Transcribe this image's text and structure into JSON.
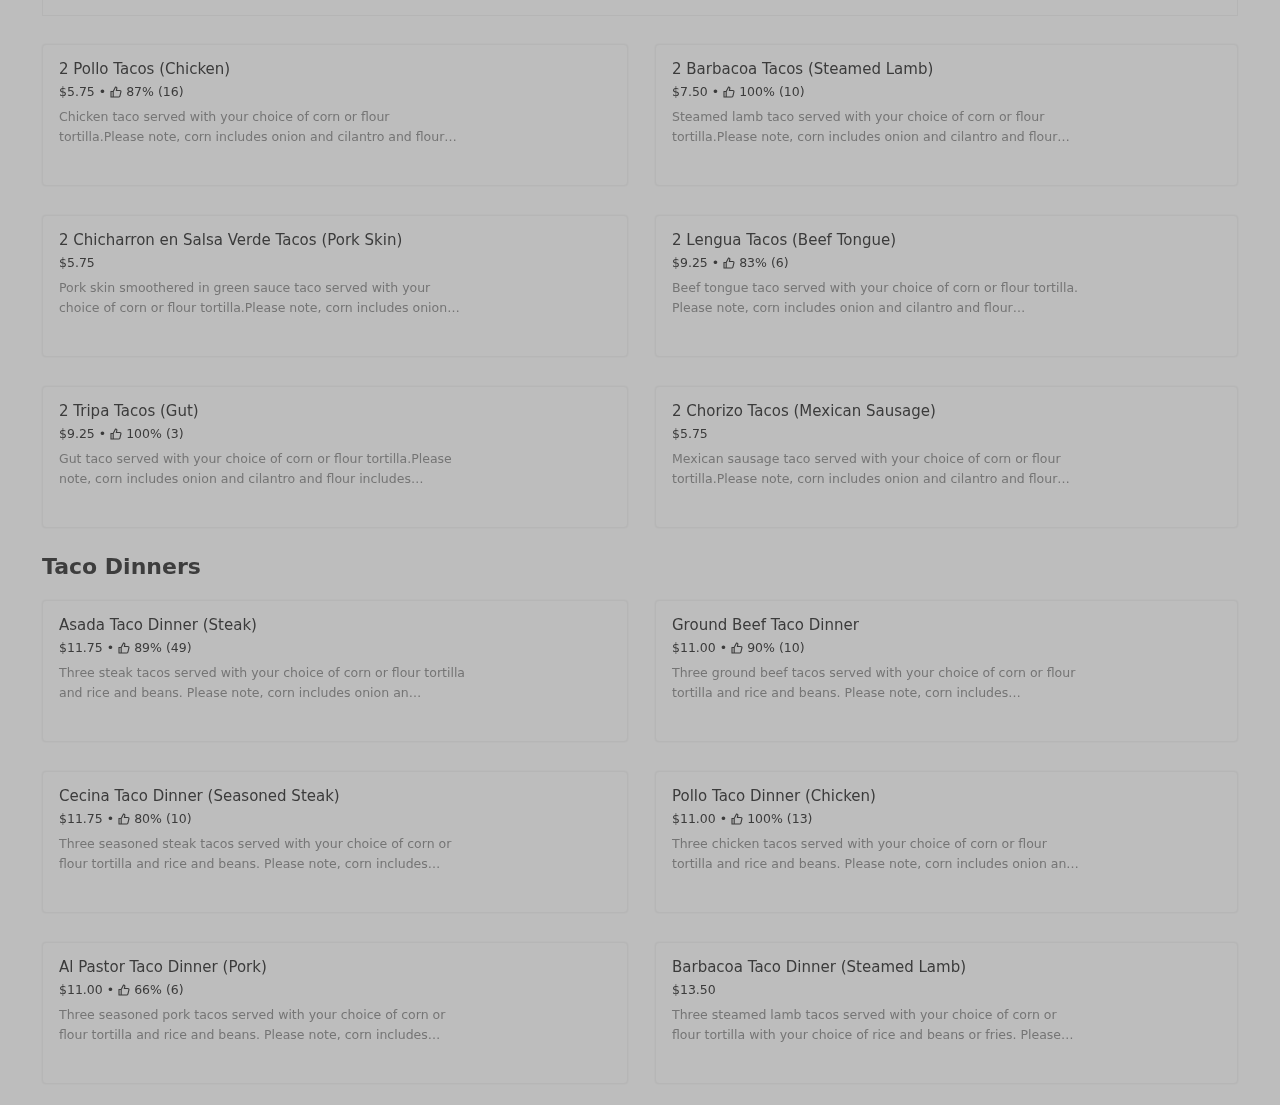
{
  "sections": [
    {
      "items": [
        {
          "name": "2 Pollo Tacos (Chicken)",
          "price": "$5.75",
          "separator": "•",
          "rating": "87% (16)",
          "description": "Chicken taco served with your choice of corn or flour tortilla.Please note, corn includes onion and cilantro and flour…"
        },
        {
          "name": "2 Barbacoa Tacos (Steamed Lamb)",
          "price": "$7.50",
          "separator": "•",
          "rating": "100% (10)",
          "description": "Steamed lamb taco served with your choice of corn or flour tortilla.Please note, corn includes onion and cilantro and flour…"
        },
        {
          "name": "2 Chicharron en Salsa Verde Tacos (Pork Skin)",
          "price": "$5.75",
          "description": "Pork skin smoothered in green sauce taco served with your choice of corn or flour tortilla.Please note, corn includes onion…"
        },
        {
          "name": "2 Lengua Tacos (Beef Tongue)",
          "price": "$9.25",
          "separator": "•",
          "rating": "83% (6)",
          "description": "Beef tongue taco served with your choice of corn or flour tortilla. Please note, corn includes onion and cilantro and flour…"
        },
        {
          "name": "2 Tripa Tacos (Gut)",
          "price": "$9.25",
          "separator": "•",
          "rating": "100% (3)",
          "description": "Gut taco served with your choice of corn or flour tortilla.Please note, corn includes onion and cilantro and flour includes…"
        },
        {
          "name": "2 Chorizo Tacos (Mexican Sausage)",
          "price": "$5.75",
          "description": "Mexican sausage taco served with your choice of corn or flour tortilla.Please note, corn includes onion and cilantro and flour…"
        }
      ]
    },
    {
      "title": "Taco Dinners",
      "items": [
        {
          "name": "Asada Taco Dinner (Steak)",
          "price": "$11.75",
          "separator": "•",
          "rating": "89% (49)",
          "description": "Three steak tacos served with your choice of corn or flour tortilla and rice and beans. Please note, corn includes onion an…"
        },
        {
          "name": "Ground Beef Taco Dinner",
          "price": "$11.00",
          "separator": "•",
          "rating": "90% (10)",
          "description": "Three ground beef tacos served with your choice of corn or flour tortilla and rice and beans. Please note, corn includes…"
        },
        {
          "name": "Cecina Taco Dinner (Seasoned Steak)",
          "price": "$11.75",
          "separator": "•",
          "rating": "80% (10)",
          "description": "Three seasoned steak tacos served with your choice of corn or flour tortilla and rice and beans. Please note, corn includes…"
        },
        {
          "name": "Pollo Taco Dinner (Chicken)",
          "price": "$11.00",
          "separator": "•",
          "rating": "100% (13)",
          "description": "Three chicken tacos served with your choice of corn or flour tortilla and rice and beans. Please note, corn includes onion an…"
        },
        {
          "name": "Al Pastor Taco Dinner (Pork)",
          "price": "$11.00",
          "separator": "•",
          "rating": "66% (6)",
          "description": "Three seasoned pork tacos served with your choice of corn or flour tortilla and rice and beans. Please note, corn includes…"
        },
        {
          "name": "Barbacoa Taco Dinner (Steamed Lamb)",
          "price": "$13.50",
          "description": "Three steamed lamb tacos served with your choice of corn or flour tortilla with your choice of rice and beans or fries. Please…"
        }
      ]
    }
  ]
}
